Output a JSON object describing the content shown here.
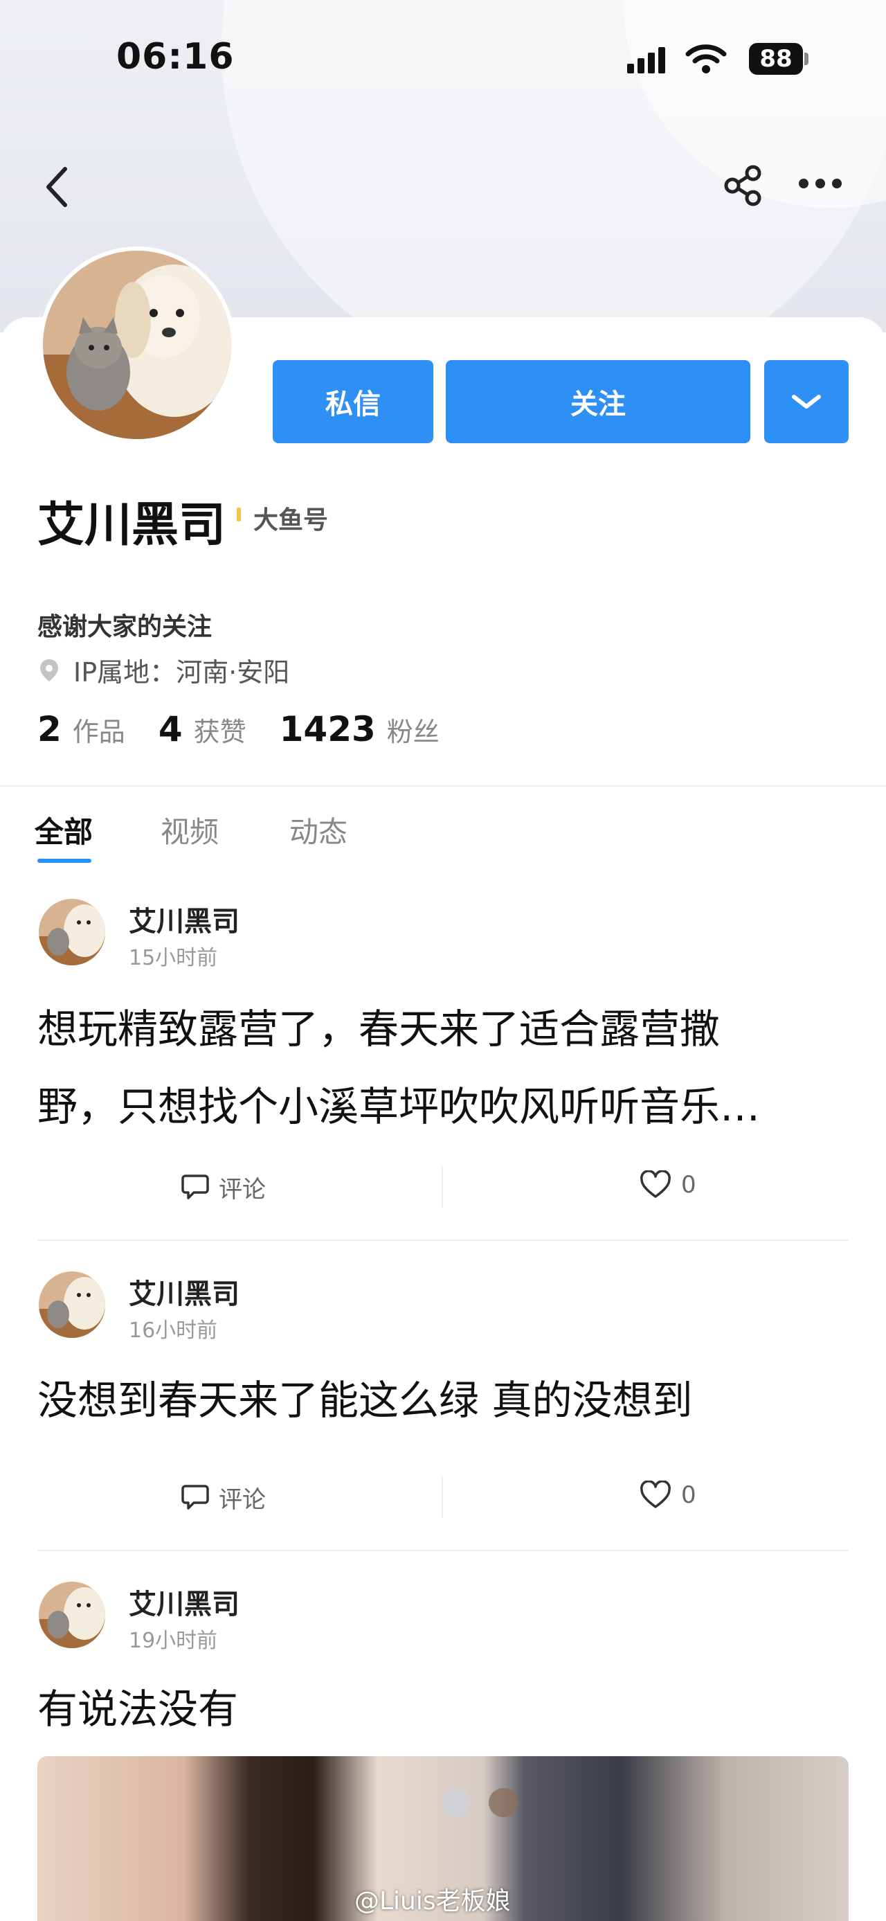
{
  "status_bar": {
    "time": "06:16",
    "battery": "88"
  },
  "profile": {
    "name": "艾川黑司",
    "badge": "大鱼号",
    "bio": "感谢大家的关注",
    "ip_location": "IP属地：河南·安阳",
    "buttons": {
      "message": "私信",
      "follow": "关注"
    },
    "stats": [
      {
        "num": "2",
        "label": "作品"
      },
      {
        "num": "4",
        "label": "获赞"
      },
      {
        "num": "1423",
        "label": "粉丝"
      }
    ]
  },
  "tabs": [
    {
      "label": "全部",
      "active": true
    },
    {
      "label": "视频",
      "active": false
    },
    {
      "label": "动态",
      "active": false
    }
  ],
  "posts": [
    {
      "author": "艾川黑司",
      "time": "15小时前",
      "lines": [
        "想玩精致露营了，春天来了适合露营撒",
        "野，只想找个小溪草坪吹吹风听听音乐…"
      ],
      "comment_label": "评论",
      "likes": "0"
    },
    {
      "author": "艾川黑司",
      "time": "16小时前",
      "lines": [
        "没想到春天来了能这么绿 真的没想到"
      ],
      "comment_label": "评论",
      "likes": "0"
    },
    {
      "author": "艾川黑司",
      "time": "19小时前",
      "lines": [
        "有说法没有"
      ]
    }
  ],
  "watermark": "@Liuis老板娘",
  "colors": {
    "accent": "#2e8ff5",
    "badge_bar": "#f2c44a"
  }
}
